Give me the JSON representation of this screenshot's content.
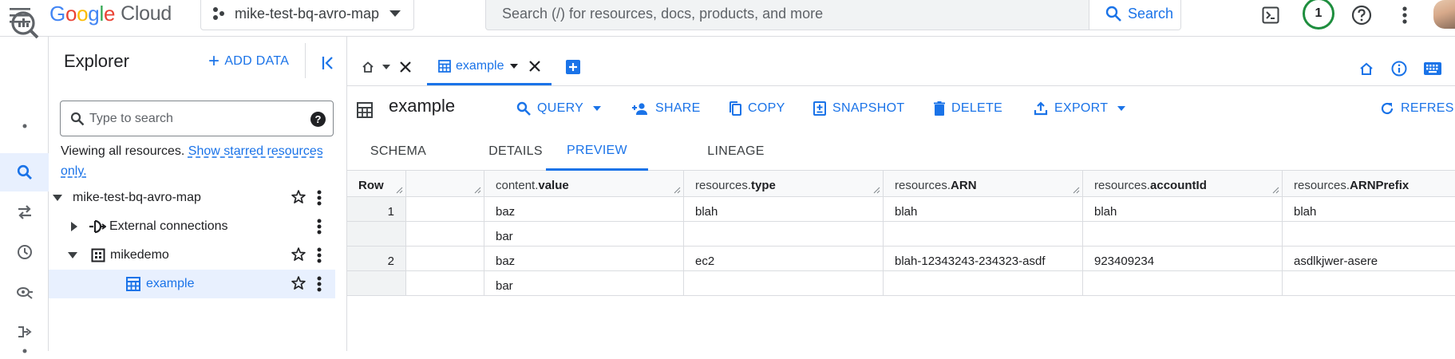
{
  "topbar": {
    "logo_google": "Google",
    "logo_cloud": "Cloud",
    "project_name": "mike-test-bq-avro-map",
    "search_placeholder": "Search (/) for resources, docs, products, and more",
    "search_button": "Search",
    "notification_count": "1"
  },
  "explorer": {
    "title": "Explorer",
    "add_data": "ADD DATA",
    "search_placeholder": "Type to search",
    "help_glyph": "?",
    "viewing_text": "Viewing all resources.",
    "viewing_link": "Show starred resources only.",
    "tree": [
      {
        "label": "mike-test-bq-avro-map",
        "kind": "project",
        "expanded": true,
        "starred": false
      },
      {
        "label": "External connections",
        "kind": "connections",
        "expanded": false
      },
      {
        "label": "mikedemo",
        "kind": "dataset",
        "expanded": true,
        "starred": false
      },
      {
        "label": "example",
        "kind": "table",
        "selected": true,
        "starred": false
      }
    ]
  },
  "editor_tabs": {
    "active_tab": "example"
  },
  "resource": {
    "title": "example",
    "actions": {
      "query": "QUERY",
      "share": "SHARE",
      "copy": "COPY",
      "snapshot": "SNAPSHOT",
      "delete": "DELETE",
      "export": "EXPORT",
      "refresh": "REFRESH"
    }
  },
  "sub_tabs": {
    "schema": "SCHEMA",
    "details": "DETAILS",
    "preview": "PREVIEW",
    "lineage": "LINEAGE",
    "active": "PREVIEW"
  },
  "preview_table": {
    "headers": {
      "row": "Row",
      "content_prefix": "content.",
      "content_field": "value",
      "type_prefix": "resources.",
      "type_field": "type",
      "arn_prefix": "resources.",
      "arn_field": "ARN",
      "account_prefix": "resources.",
      "account_field": "accountId",
      "arnprefix_prefix": "resources.",
      "arnprefix_field": "ARNPrefix"
    },
    "rows": [
      {
        "row": "1",
        "content_values": [
          "baz",
          "bar"
        ],
        "type": "blah",
        "arn": "blah",
        "account": "blah",
        "arn_prefix": "blah"
      },
      {
        "row": "2",
        "content_values": [
          "baz",
          "bar"
        ],
        "type": "ec2",
        "arn": "blah-12343243-234323-asdf",
        "account": "923409234",
        "arn_prefix": "asdlkjwer-asere"
      }
    ]
  },
  "colors": {
    "accent": "#1a73e8",
    "selected_bg": "#e8f0fe",
    "badge_ring": "#1e8e3e"
  }
}
